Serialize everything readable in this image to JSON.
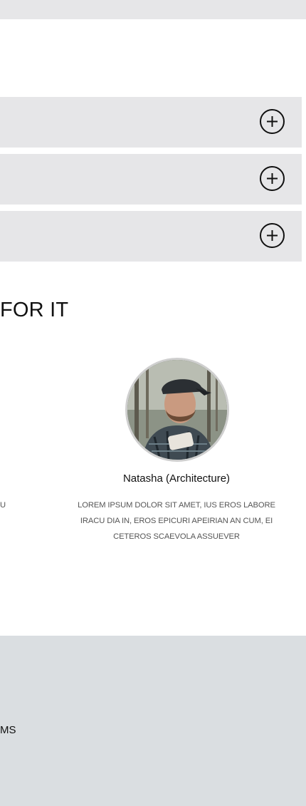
{
  "accordion": {
    "items": [
      {
        "icon": "plus-circle-icon"
      },
      {
        "icon": "plus-circle-icon"
      },
      {
        "icon": "plus-circle-icon"
      }
    ]
  },
  "team_section": {
    "title": "FOR IT",
    "previous_member_desc_fragment": "U",
    "member": {
      "name": "Natasha (Architecture)",
      "description": "LOREM IPSUM DOLOR SIT AMET, IUS EROS LABORE IRACU DIA IN, EROS EPICURI APEIRIAN AN CUM, EI CETEROS SCAEVOLA ASSUEVER",
      "avatar_icon": "person-photo"
    }
  },
  "footer": {
    "text_fragment": "MS"
  }
}
